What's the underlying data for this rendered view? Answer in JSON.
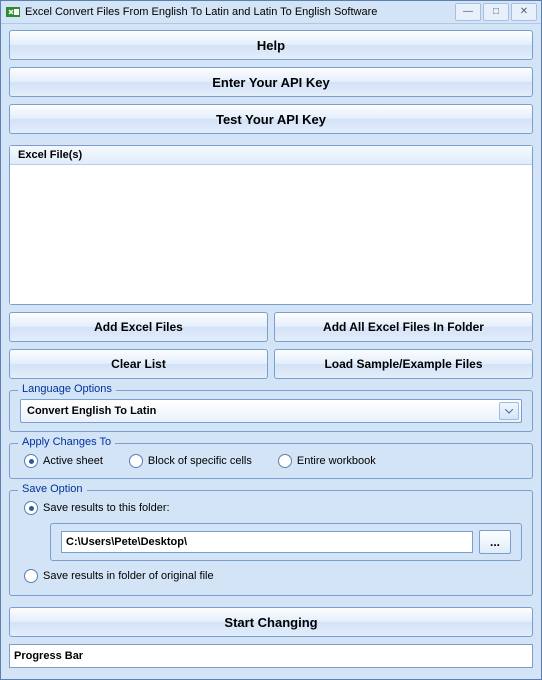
{
  "window": {
    "title": "Excel Convert Files From English To Latin and Latin To English Software"
  },
  "buttons": {
    "help": "Help",
    "enter_api_key": "Enter Your API Key",
    "test_api_key": "Test Your API Key",
    "add_files": "Add Excel Files",
    "add_folder": "Add All Excel Files In Folder",
    "clear_list": "Clear List",
    "load_sample": "Load Sample/Example Files",
    "start": "Start Changing",
    "browse": "..."
  },
  "files": {
    "header": "Excel File(s)"
  },
  "language": {
    "legend": "Language Options",
    "selected": "Convert English To Latin"
  },
  "apply": {
    "legend": "Apply Changes To",
    "options": {
      "active": "Active sheet",
      "block": "Block of specific cells",
      "entire": "Entire workbook"
    },
    "selected": "active"
  },
  "save": {
    "legend": "Save Option",
    "to_folder_label": "Save results to this folder:",
    "folder_path": "C:\\Users\\Pete\\Desktop\\",
    "original_label": "Save results in folder of original file",
    "selected": "to_folder"
  },
  "progress": {
    "label": "Progress Bar"
  }
}
